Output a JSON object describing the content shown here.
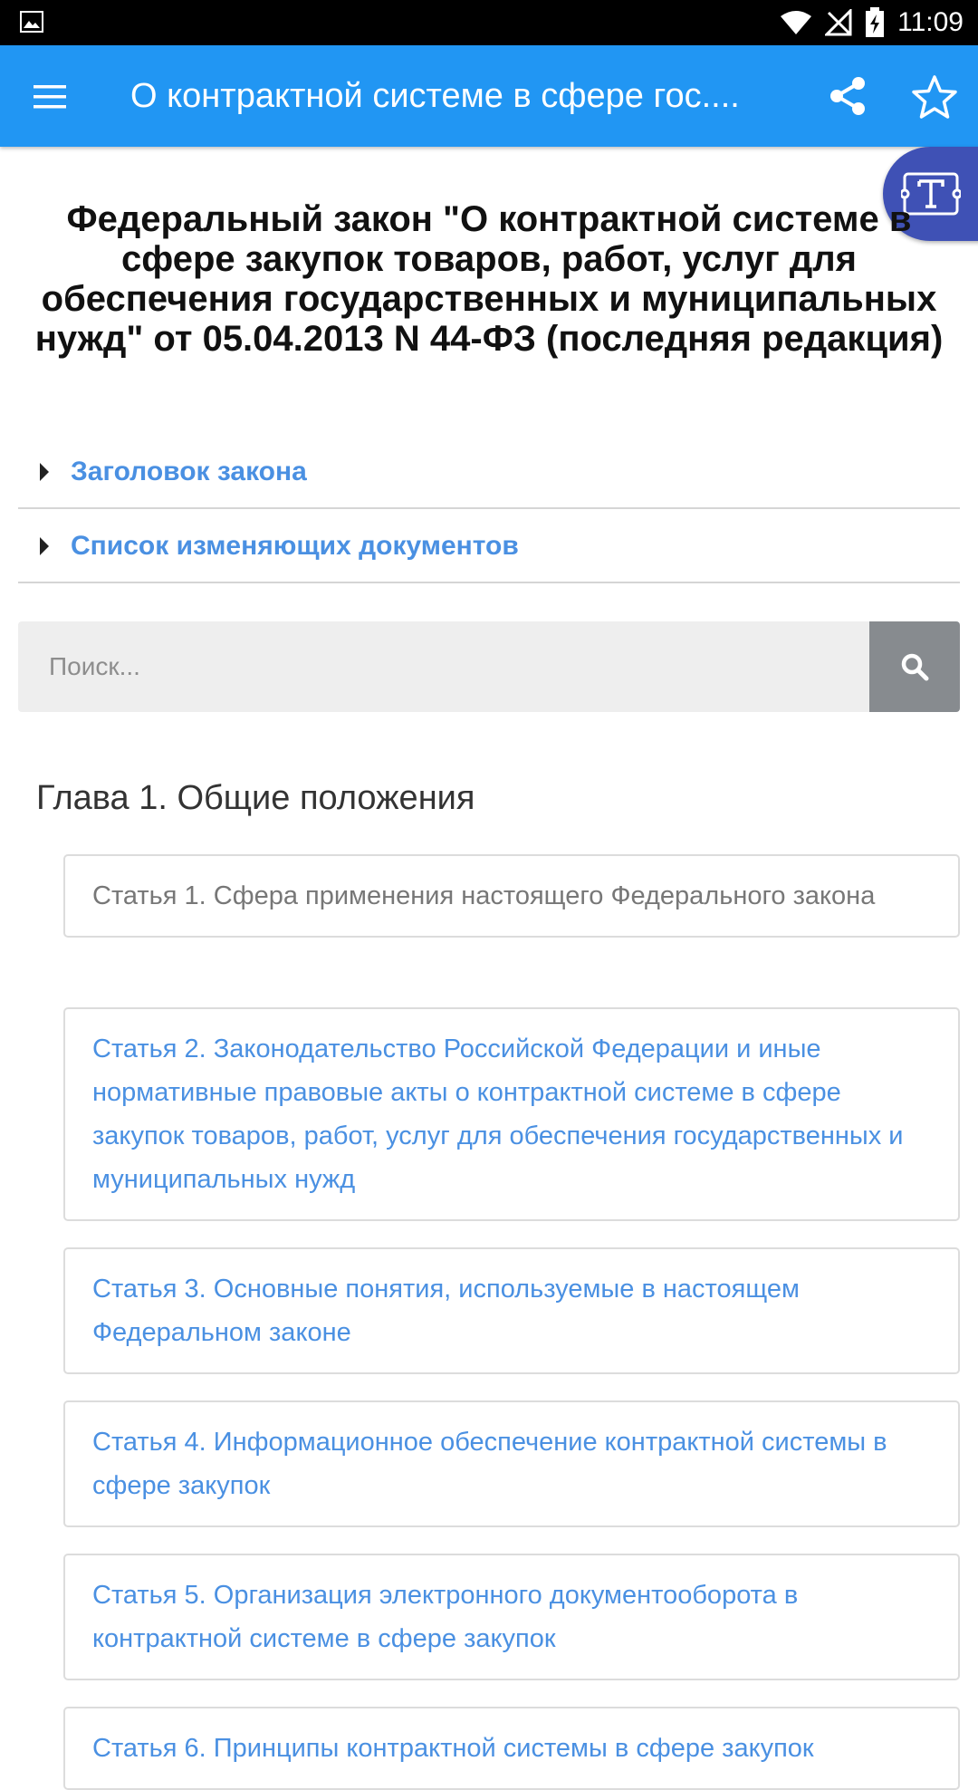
{
  "status_bar": {
    "time": "11:09",
    "icons": [
      "gallery-icon",
      "wifi-icon",
      "no-signal-icon",
      "battery-charging-icon"
    ]
  },
  "app_bar": {
    "title": "О контрактной системе в сфере гос....",
    "menu_icon": "hamburger-menu-icon",
    "share_icon": "share-icon",
    "favorite_icon": "star-outline-icon",
    "color": "#2196F3"
  },
  "font_button": {
    "icon": "text-size-icon",
    "color": "#3F51B5"
  },
  "document": {
    "title": "Федеральный закон \"О контрактной системе в сфере закупок товаров, работ, услуг для обеспечения государственных и муниципальных нужд\" от 05.04.2013 N 44-ФЗ (последняя редакция)"
  },
  "sections": [
    {
      "label": "Заголовок закона"
    },
    {
      "label": "Список изменяющих документов"
    }
  ],
  "search": {
    "placeholder": "Поиск...",
    "icon": "search-icon"
  },
  "chapter": {
    "title": "Глава 1. Общие положения"
  },
  "articles": [
    {
      "text": "Статья 1. Сфера применения настоящего Федерального закона",
      "style": "plain"
    },
    {
      "text": "Статья 2. Законодательство Российской Федерации и иные нормативные правовые акты о контрактной системе в сфере закупок товаров, работ, услуг для обеспечения государственных и муниципальных нужд",
      "style": "link"
    },
    {
      "text": "Статья 3. Основные понятия, используемые в настоящем Федеральном законе",
      "style": "link"
    },
    {
      "text": "Статья 4. Информационное обеспечение контрактной системы в сфере закупок",
      "style": "link"
    },
    {
      "text": "Статья 5. Организация электронного документооборота в контрактной системе в сфере закупок",
      "style": "link"
    },
    {
      "text": "Статья 6. Принципы контрактной системы в сфере закупок",
      "style": "link"
    }
  ],
  "colors": {
    "link": "#4A90E2",
    "plain_text": "#777777"
  }
}
